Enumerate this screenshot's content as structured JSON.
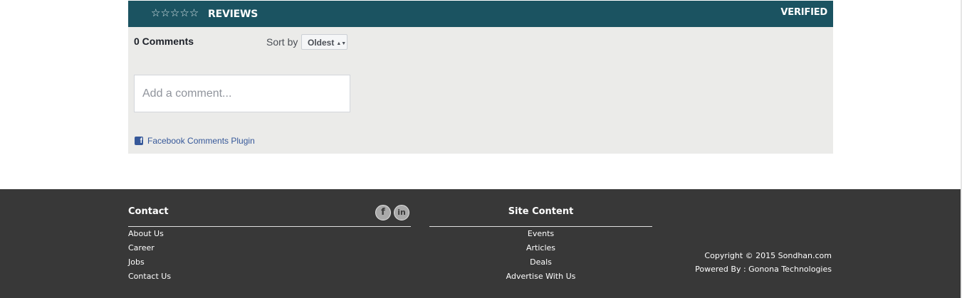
{
  "reviews": {
    "stars": "☆☆☆☆☆",
    "title": "REVIEWS",
    "verified": "VERIFIED",
    "header_color": "#1b5361"
  },
  "comments": {
    "count_label": "0 Comments",
    "sort_label": "Sort by",
    "sort_selected": "Oldest",
    "input_placeholder": "Add a comment...",
    "plugin_label": "Facebook Comments Plugin"
  },
  "footer": {
    "contact": {
      "heading": "Contact",
      "links": [
        "About Us",
        "Career",
        "Jobs",
        "Contact Us"
      ]
    },
    "social": {
      "facebook_glyph": "f",
      "linkedin_glyph": "in"
    },
    "site_content": {
      "heading": "Site Content",
      "links": [
        "Events",
        "Articles",
        "Deals",
        "Advertise With Us"
      ]
    },
    "copyright_line": "Copyright © 2015 Sondhan.com",
    "powered_by_line": "Powered By : Gonona Technologies",
    "background_color": "#383838"
  }
}
